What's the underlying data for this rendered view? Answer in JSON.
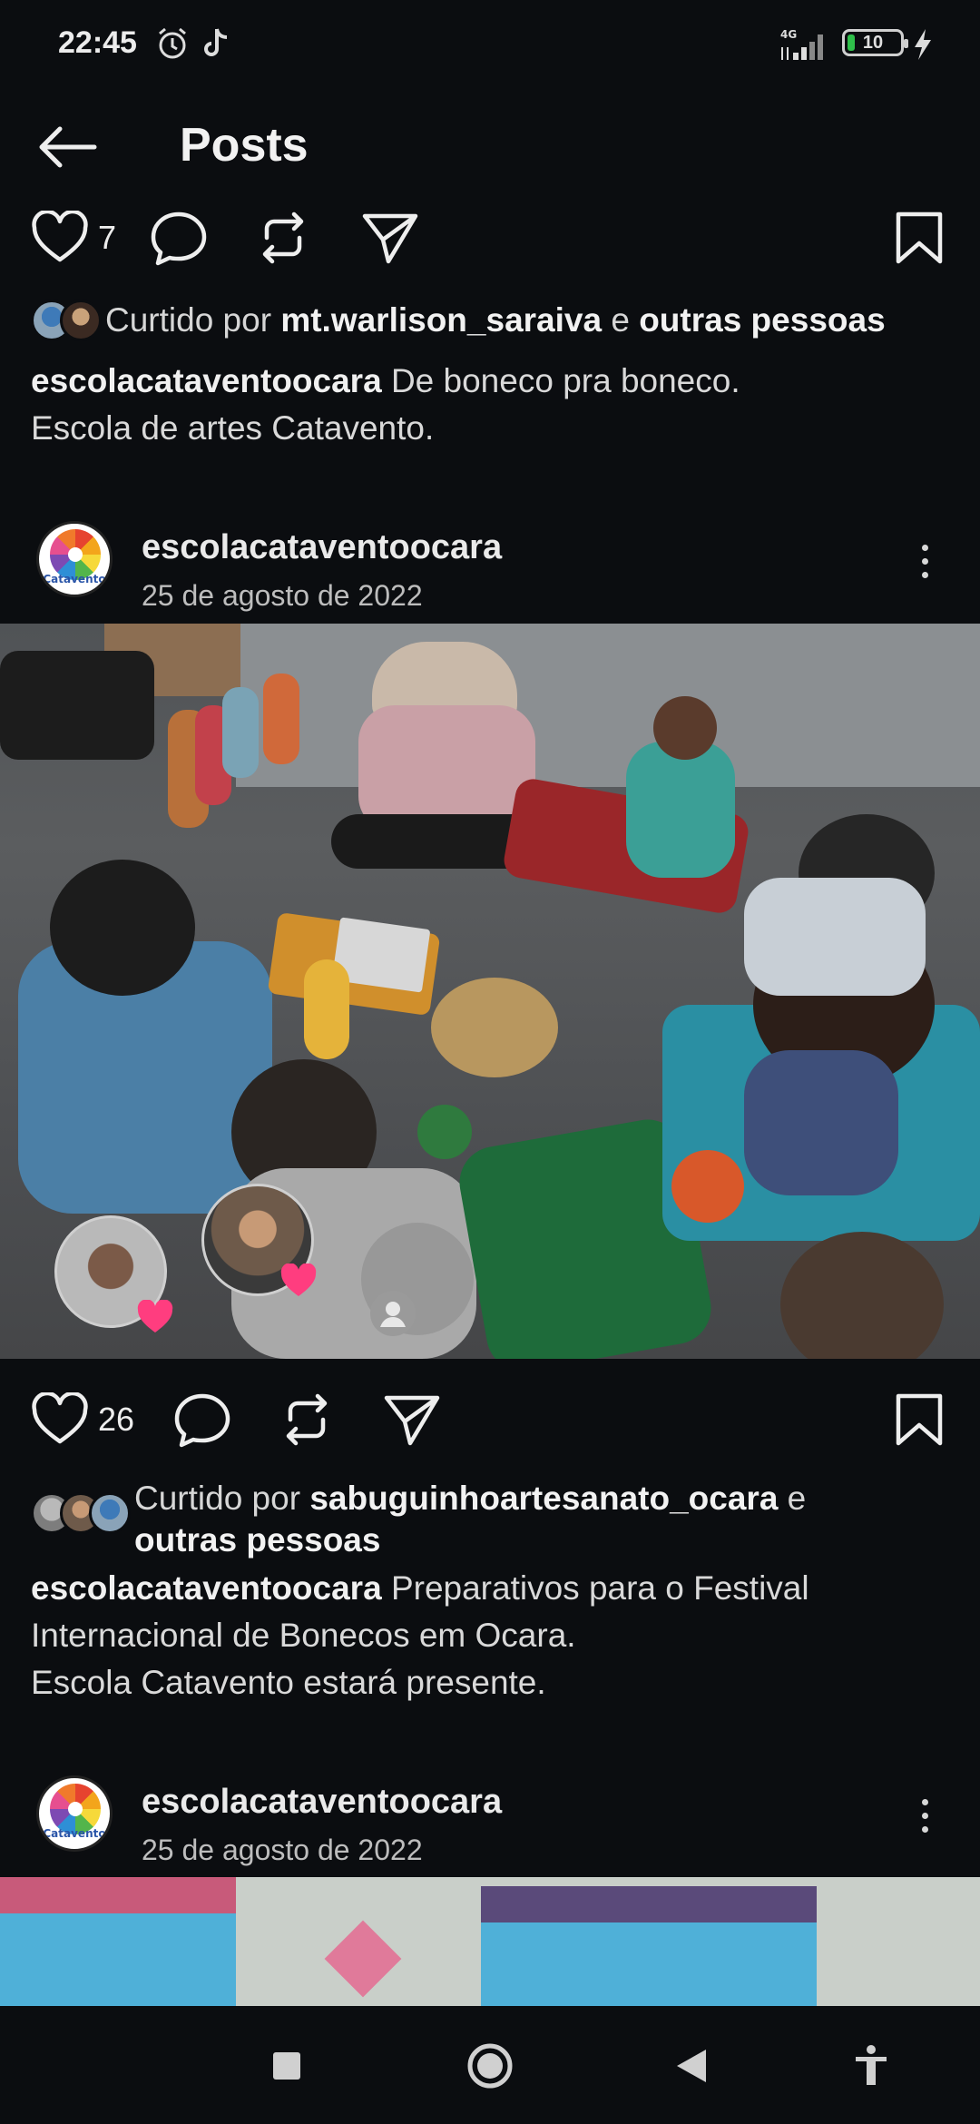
{
  "status_bar": {
    "time": "22:45",
    "network": "4G",
    "battery_level": "10",
    "icons": [
      "alarm-icon",
      "tiktok-icon",
      "signal-icon",
      "battery-icon",
      "charging-bolt-icon"
    ]
  },
  "header": {
    "title": "Posts",
    "back_icon": "arrow-left-icon"
  },
  "post_previous": {
    "likes_count": "7",
    "liked_by_prefix": "Curtido por ",
    "liked_by_user": "mt.warlison_saraiva",
    "liked_by_mid": " e ",
    "liked_by_others": "outras pessoas",
    "caption_user": "escolacataventoocara",
    "caption_text": " De boneco pra boneco.",
    "caption_line2": "Escola de artes Catavento."
  },
  "post_main": {
    "username": "escolacataventoocara",
    "date": "25 de agosto de 2022",
    "profile_logo_text": "Catavento",
    "likes_count": "26",
    "liked_by_prefix": "Curtido por ",
    "liked_by_user": "sabuguinhoartesanato_ocara",
    "liked_by_mid": " e",
    "liked_by_others": "outras pessoas",
    "caption_user": "escolacataventoocara",
    "caption_text": " Preparativos para o Festival Internacional de Bonecos em Ocara.",
    "caption_line2": "Escola Catavento estará presente."
  },
  "post_next": {
    "username": "escolacataventoocara",
    "date": "25 de agosto de 2022",
    "profile_logo_text": "Catavento"
  },
  "nav_bar": {
    "icons": [
      "recents-square-icon",
      "home-circle-icon",
      "back-triangle-icon",
      "accessibility-icon"
    ]
  },
  "colors": {
    "background": "#0b0d10",
    "text_primary": "#f2f2f2",
    "text_secondary": "#bdbdbd",
    "heart_reaction": "#ff3d7f"
  }
}
